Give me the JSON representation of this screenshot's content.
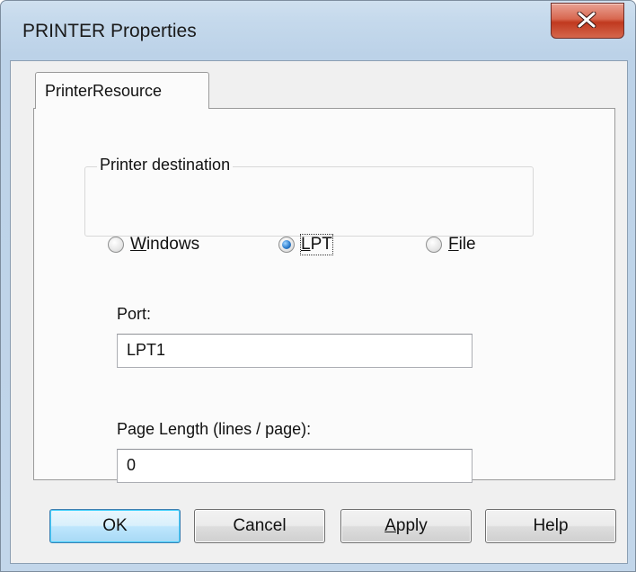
{
  "window": {
    "title": "PRINTER Properties",
    "close_icon": "close-x-icon"
  },
  "tabs": [
    {
      "label": "PrinterResource",
      "selected": true
    }
  ],
  "printer_destination": {
    "group_label": "Printer destination",
    "options": [
      {
        "label": "Windows",
        "mnemonic": "W",
        "rest": "indows",
        "checked": false
      },
      {
        "label": "LPT",
        "mnemonic": "L",
        "rest": "PT",
        "checked": true
      },
      {
        "label": "File",
        "mnemonic": "F",
        "rest": "ile",
        "checked": false
      }
    ]
  },
  "port": {
    "label": "Port:",
    "value": "LPT1"
  },
  "page_length": {
    "label": "Page Length (lines / page):",
    "value": "0"
  },
  "buttons": {
    "ok": "OK",
    "cancel": "Cancel",
    "apply_mnemonic": "A",
    "apply_rest": "pply",
    "help": "Help"
  },
  "colors": {
    "titlebar": "#c5d9ec",
    "close_button": "#c0391f",
    "dialog_face": "#f0f0f0",
    "default_button": "#bee6fd"
  }
}
